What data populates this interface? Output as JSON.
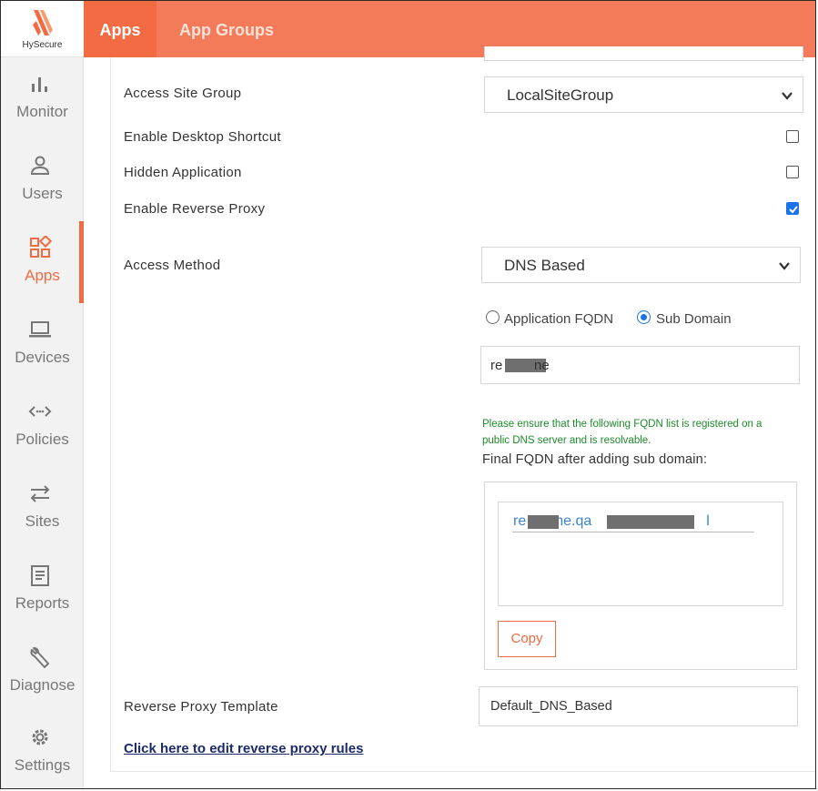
{
  "brand": {
    "name": "HySecure",
    "accent": "#f26b43"
  },
  "sidebar": {
    "items": [
      {
        "label": "Monitor",
        "icon": "bar-chart-icon"
      },
      {
        "label": "Users",
        "icon": "user-icon"
      },
      {
        "label": "Apps",
        "icon": "apps-grid-icon",
        "active": true
      },
      {
        "label": "Devices",
        "icon": "laptop-icon"
      },
      {
        "label": "Policies",
        "icon": "code-arrows-icon"
      },
      {
        "label": "Sites",
        "icon": "swap-arrows-icon"
      },
      {
        "label": "Reports",
        "icon": "document-icon"
      },
      {
        "label": "Diagnose",
        "icon": "wrench-icon"
      },
      {
        "label": "Settings",
        "icon": "gear-icon"
      }
    ]
  },
  "tabs": {
    "apps": "Apps",
    "app_groups": "App Groups"
  },
  "form": {
    "access_site_group": {
      "label": "Access Site Group",
      "value": "LocalSiteGroup"
    },
    "enable_desktop_shortcut": {
      "label": "Enable Desktop Shortcut",
      "checked": false
    },
    "hidden_application": {
      "label": "Hidden Application",
      "checked": false
    },
    "enable_reverse_proxy": {
      "label": "Enable Reverse Proxy",
      "checked": true
    },
    "access_method": {
      "label": "Access Method",
      "value": "DNS Based"
    },
    "radio": {
      "option1": "Application FQDN",
      "option2": "Sub Domain",
      "selected": "Sub Domain"
    },
    "sub_domain": {
      "prefix": "re",
      "suffix": "ne"
    },
    "note": "Please ensure that the following FQDN list is registered on a public DNS server and is resolvable.",
    "final_fqdn_label": "Final FQDN after adding sub domain:",
    "fqdn": {
      "part1": "re",
      "part2": "ne.qa",
      "part3": "l"
    },
    "copy_label": "Copy",
    "reverse_proxy_template": {
      "label": "Reverse Proxy Template",
      "value": "Default_DNS_Based"
    },
    "edit_link": "Click here to edit reverse proxy rules"
  }
}
